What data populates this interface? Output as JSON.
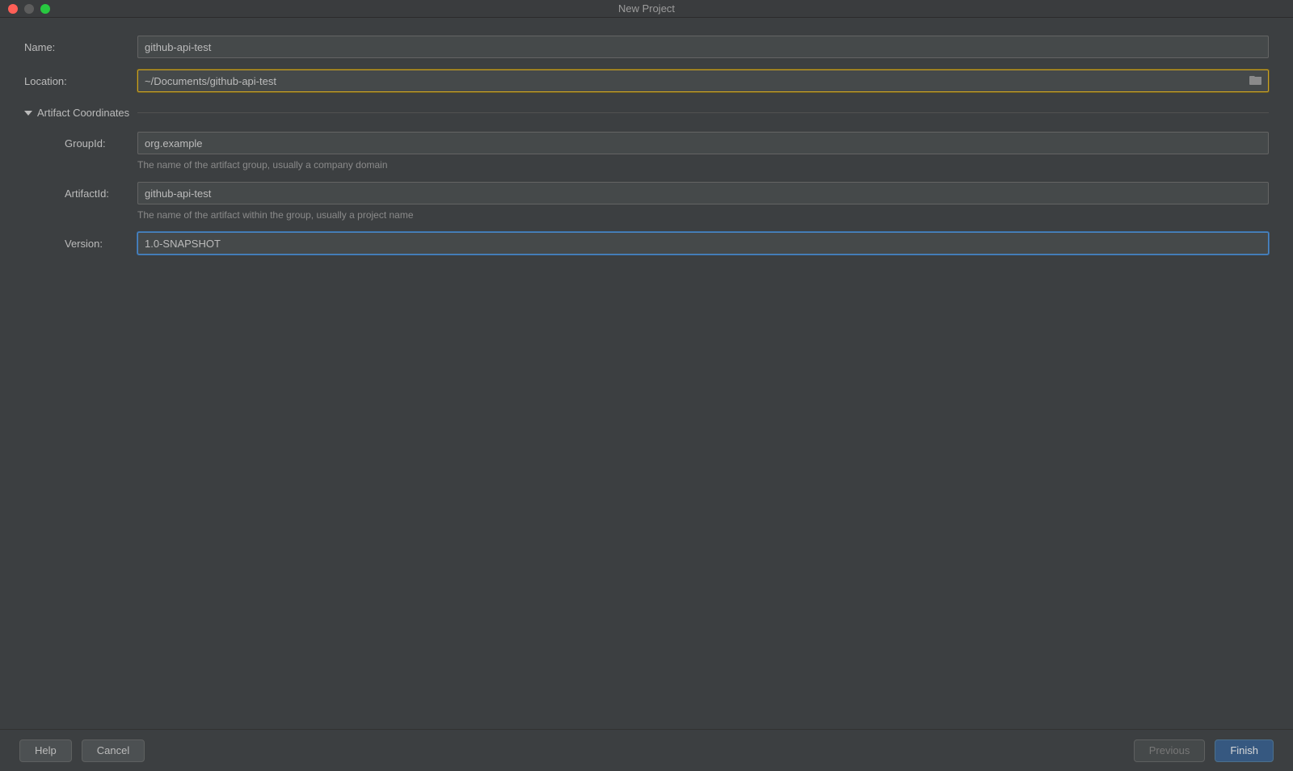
{
  "title": "New Project",
  "fields": {
    "name": {
      "label": "Name:",
      "value": "github-api-test"
    },
    "location": {
      "label": "Location:",
      "value": "~/Documents/github-api-test"
    }
  },
  "section": {
    "title": "Artifact Coordinates",
    "groupId": {
      "label": "GroupId:",
      "value": "org.example",
      "hint": "The name of the artifact group, usually a company domain"
    },
    "artifactId": {
      "label": "ArtifactId:",
      "value": "github-api-test",
      "hint": "The name of the artifact within the group, usually a project name"
    },
    "version": {
      "label": "Version:",
      "value": "1.0-SNAPSHOT"
    }
  },
  "buttons": {
    "help": "Help",
    "cancel": "Cancel",
    "previous": "Previous",
    "finish": "Finish"
  }
}
